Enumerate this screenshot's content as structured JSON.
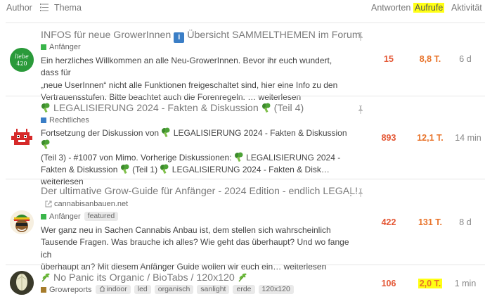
{
  "header": {
    "author": "Author",
    "thema": "Thema",
    "antworten": "Antworten",
    "aufrufe": "Aufrufe",
    "aktivitaet": "Aktivität"
  },
  "topics": [
    {
      "title_pre": "INFOS für neue GrowerInnen",
      "title_icon": "i",
      "title_post": "Übersicht SAMMELTHEMEN im Forum",
      "category": "Anfänger",
      "category_color": "#3ab54a",
      "excerpt_1": "Ein herzliches Willkommen an alle Neu-GrowerInnen. Bevor ihr euch wundert, dass für",
      "excerpt_2": "„neue UserInnen“ nicht alle Funktionen freigeschaltet sind, hier eine Info zu den",
      "excerpt_3": "Vertrauensstufen. Bitte beachtet auch die Forenregeln. …",
      "more": "weiterlesen",
      "replies": "15",
      "views": "8,8 T.",
      "activity": "6 d"
    },
    {
      "title": "LEGALISIERUNG 2024 - Fakten & Diskussion",
      "title_suffix": "(Teil 4)",
      "category": "Rechtliches",
      "category_color": "#3a7ec6",
      "excerpt_1a": "Fortsetzung der Diskussion von",
      "excerpt_1b": "LEGALISIERUNG 2024 - Fakten & Diskussion",
      "excerpt_2a": "(Teil 3) - #1007 von Mimo. Vorherige Diskussionen:",
      "excerpt_2b": "LEGALISIERUNG 2024 -",
      "excerpt_3a": "Fakten & Diskussion",
      "excerpt_3b": "(Teil 1)",
      "excerpt_3c": "LEGALISIERUNG 2024 - Fakten & Disk…",
      "more": "weiterlesen",
      "replies": "893",
      "views": "12,1 T.",
      "activity": "14 min"
    },
    {
      "title": "Der ultimative Grow-Guide für Anfänger - 2024 Edition - endlich LEGAL!",
      "link": "cannabisanbauen.net",
      "category": "Anfänger",
      "category_color": "#3ab54a",
      "tag": "featured",
      "excerpt_1": "Wer ganz neu in Sachen Cannabis Anbau ist, dem stellen sich wahrscheinlich",
      "excerpt_2": "Tausende Fragen. Was brauche ich alles? Wie geht das überhaupt? Und wo fange ich",
      "excerpt_3": "überhaupt an? Mit diesem Anfänger Guide wollen wir euch ein…",
      "more": "weiterlesen",
      "replies": "422",
      "views": "131 T.",
      "activity": "8 d"
    },
    {
      "title": "No Panic its Organic / BioTabs / 120x120",
      "category": "Growreports",
      "category_color": "#a67c2b",
      "tags": [
        "indoor",
        "led",
        "organisch",
        "sanlight",
        "erde",
        "120x120"
      ],
      "replies": "106",
      "views": "2,0 T.",
      "activity": "1 min"
    }
  ],
  "icons": {
    "list": "list-icon",
    "pin": "pin-icon",
    "info": "info-icon",
    "broccoli": "broccoli-emoji",
    "herb": "herb-emoji",
    "link": "external-link-icon",
    "home": "house-icon",
    "closed": "exclamation-icon"
  },
  "avatar_text": {
    "line1": "liebe",
    "line2": "420"
  }
}
